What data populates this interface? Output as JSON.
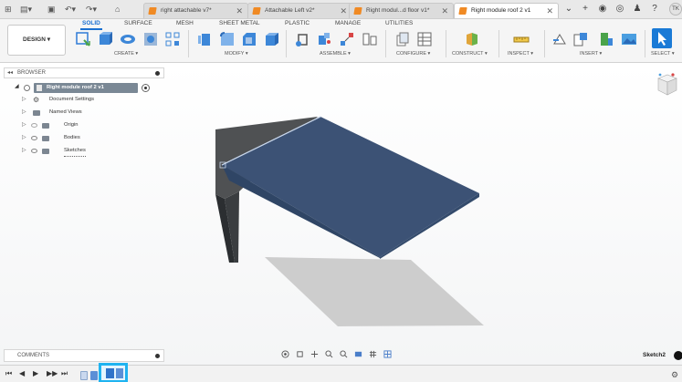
{
  "tabs": {
    "items": [
      {
        "label": "right attachable v7*",
        "active": false
      },
      {
        "label": "Attachable Left v2*",
        "active": false
      },
      {
        "label": "Right modul...d floor v1*",
        "active": false
      },
      {
        "label": "Right module roof 2 v1",
        "active": true
      }
    ],
    "close_glyph": "✕"
  },
  "user": {
    "initials": "TK"
  },
  "toolbar": {
    "workspace_tabs": [
      "SOLID",
      "SURFACE",
      "MESH",
      "SHEET METAL",
      "PLASTIC",
      "MANAGE",
      "UTILITIES"
    ],
    "active_workspace": "SOLID",
    "design_button": "DESIGN ▾",
    "groups": [
      "CREATE ▾",
      "MODIFY ▾",
      "ASSEMBLE ▾",
      "CONFIGURE ▾",
      "CONSTRUCT ▾",
      "INSPECT ▾",
      "INSERT ▾",
      "SELECT ▾"
    ]
  },
  "browser": {
    "title": "BROWSER",
    "root_label": "Right module roof 2 v1",
    "items": [
      "Document Settings",
      "Named Views",
      "Origin",
      "Bodies",
      "Sketches"
    ]
  },
  "comments": {
    "title": "COMMENTS"
  },
  "status": {
    "sketch_label": "Sketch2"
  },
  "colors": {
    "accent": "#1a6fd1",
    "roof": "#4a607e",
    "post": "#2b2e31",
    "timeline_highlight": "#1fb3f0"
  }
}
